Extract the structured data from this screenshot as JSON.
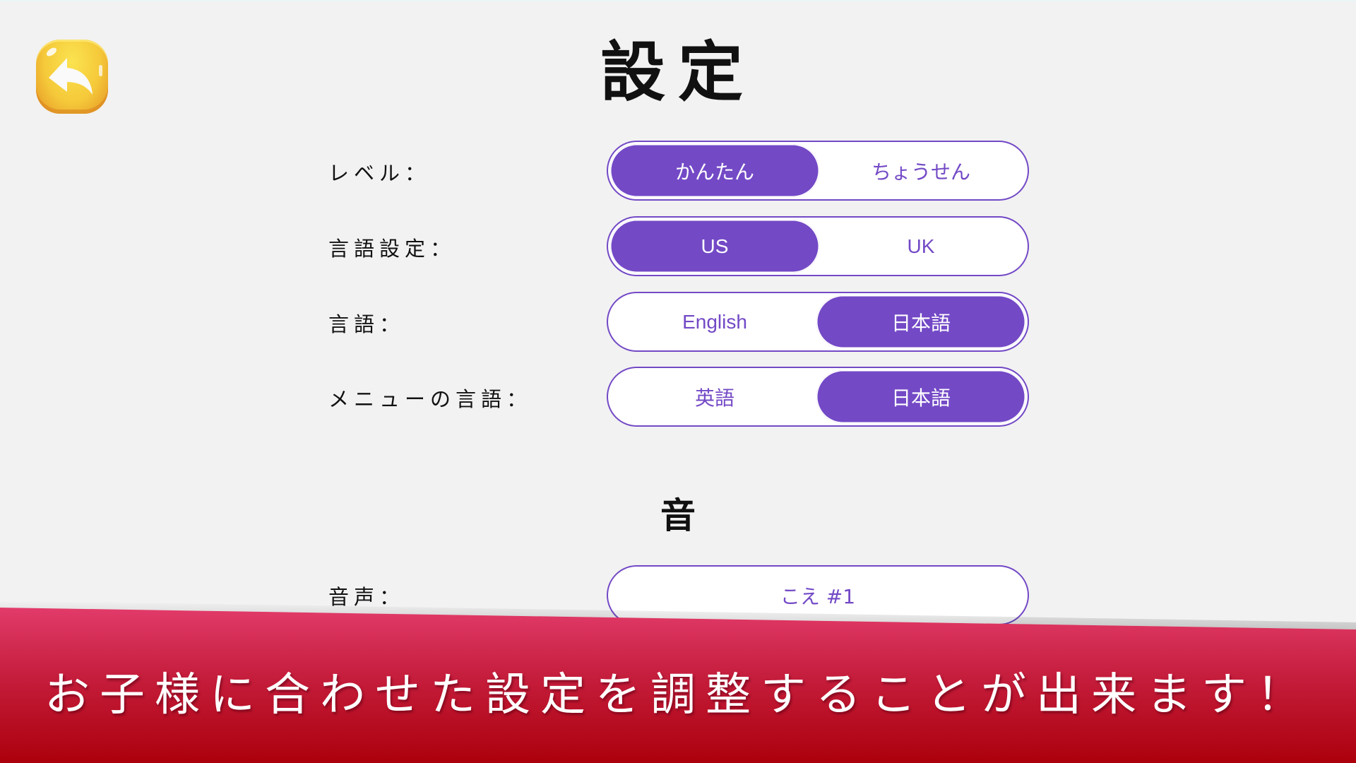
{
  "header": {
    "title": "設定",
    "back_icon": "back-arrow-icon"
  },
  "settings": [
    {
      "label": "レベル：",
      "options": [
        "かんたん",
        "ちょうせん"
      ],
      "selected": 0
    },
    {
      "label": "言語設定：",
      "options": [
        "US",
        "UK"
      ],
      "selected": 0
    },
    {
      "label": "言語：",
      "options": [
        "English",
        "日本語"
      ],
      "selected": 1
    },
    {
      "label": "メニューの言語：",
      "options": [
        "英語",
        "日本語"
      ],
      "selected": 1
    }
  ],
  "sound": {
    "heading": "音",
    "voice_label": "音声：",
    "voice_value": "こえ #1"
  },
  "banner": {
    "text": "お子様に合わせた設定を調整することが出来ます！"
  },
  "colors": {
    "accent": "#7349c6",
    "background": "#f2f2f2",
    "banner_top": "#e23b6a",
    "banner_bottom": "#ac000c",
    "back_button": "#f5c93a"
  }
}
